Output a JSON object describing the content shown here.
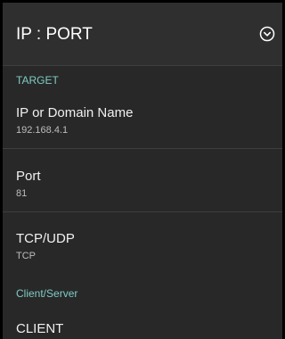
{
  "colors": {
    "panel_background": "#282828",
    "header_background": "#2f2f2f",
    "accent": "#80cbc4",
    "title_text": "#f0f0f0",
    "summary_text": "#bdbdbd"
  },
  "header": {
    "title": "IP : PORT",
    "menu_icon": "chevron-down-circle-icon"
  },
  "sections": {
    "target": {
      "label": "TARGET"
    },
    "client_server": {
      "label": "Client/Server"
    }
  },
  "preferences": {
    "ip_domain": {
      "title": "IP or Domain Name",
      "value": "192.168.4.1"
    },
    "port": {
      "title": "Port",
      "value": "81"
    },
    "protocol": {
      "title": "TCP/UDP",
      "value": "TCP"
    },
    "mode": {
      "title": "CLIENT"
    }
  }
}
